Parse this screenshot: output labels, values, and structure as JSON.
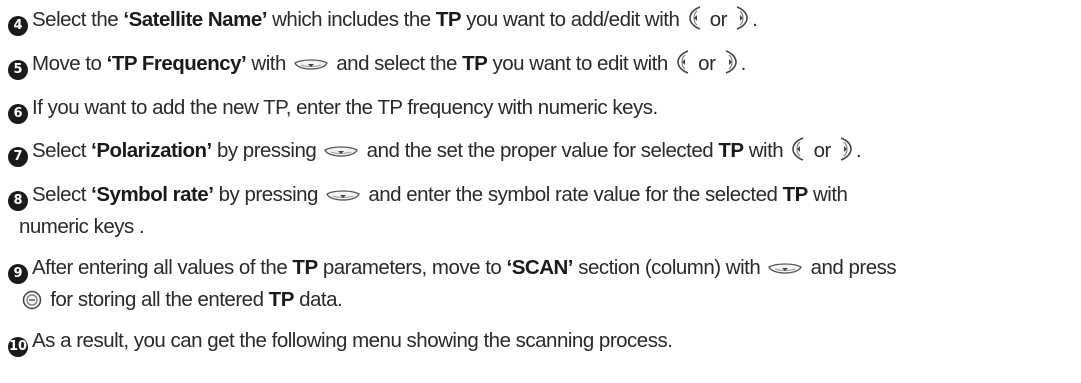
{
  "steps": [
    {
      "number": "4",
      "segments": [
        {
          "t": "Select the "
        },
        {
          "t": "‘Satellite Name’",
          "b": true
        },
        {
          "t": " which includes the "
        },
        {
          "t": "TP",
          "b": true
        },
        {
          "t": " you want to add/edit with "
        },
        {
          "icon": "left-button-icon"
        },
        {
          "t": " or "
        },
        {
          "icon": "right-button-icon"
        },
        {
          "t": "."
        }
      ]
    },
    {
      "number": "5",
      "segments": [
        {
          "t": "Move to "
        },
        {
          "t": "‘TP Frequency’",
          "b": true
        },
        {
          "t": " with "
        },
        {
          "icon": "down-button-icon"
        },
        {
          "t": " and select the "
        },
        {
          "t": "TP",
          "b": true
        },
        {
          "t": " you want to edit with "
        },
        {
          "icon": "left-button-icon"
        },
        {
          "t": " or "
        },
        {
          "icon": "right-button-icon"
        },
        {
          "t": "."
        }
      ]
    },
    {
      "number": "6",
      "segments": [
        {
          "t": "If you want to add the new TP, enter the TP frequency with numeric keys."
        }
      ]
    },
    {
      "number": "7",
      "segments": [
        {
          "t": "Select "
        },
        {
          "t": "‘Polarization’",
          "b": true
        },
        {
          "t": " by pressing "
        },
        {
          "icon": "down-button-icon"
        },
        {
          "t": " and the set the proper value for selected "
        },
        {
          "t": "TP",
          "b": true
        },
        {
          "t": " with "
        },
        {
          "icon": "left-button-icon"
        },
        {
          "t": " or "
        },
        {
          "icon": "right-button-icon"
        },
        {
          "t": "."
        }
      ]
    },
    {
      "number": "8",
      "segments": [
        {
          "t": "Select "
        },
        {
          "t": "‘Symbol rate’",
          "b": true
        },
        {
          "t": " by pressing "
        },
        {
          "icon": "down-button-icon"
        },
        {
          "t": " and enter the symbol rate value for the selected "
        },
        {
          "t": "TP",
          "b": true
        },
        {
          "t": " with"
        },
        {
          "br": true
        },
        {
          "t": "numeric keys ."
        }
      ]
    },
    {
      "number": "9",
      "segments": [
        {
          "t": "After entering all values of the "
        },
        {
          "t": "TP",
          "b": true
        },
        {
          "t": " parameters, move to "
        },
        {
          "t": "‘SCAN’",
          "b": true
        },
        {
          "t": " section (column) with "
        },
        {
          "icon": "down-button-icon"
        },
        {
          "t": " and press"
        },
        {
          "br": true
        },
        {
          "icon": "ok-button-icon"
        },
        {
          "t": " for storing all the entered "
        },
        {
          "t": "TP",
          "b": true
        },
        {
          "t": " data."
        }
      ]
    },
    {
      "number": "10",
      "segments": [
        {
          "t": "As a result, you can get the following menu showing the scanning process."
        }
      ]
    }
  ]
}
